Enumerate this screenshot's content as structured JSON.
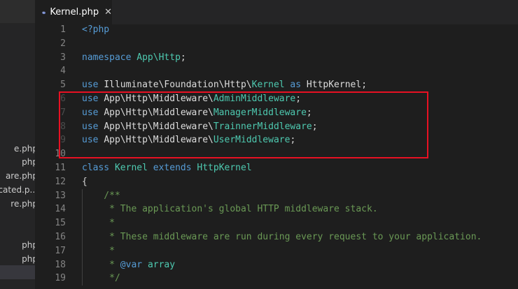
{
  "tab": {
    "title": "Kernel.php",
    "close": "✕",
    "icon": "elephant-php-icon"
  },
  "sidebar": {
    "items": [
      {
        "label": "e.php",
        "selected": false
      },
      {
        "label": "php",
        "selected": false
      },
      {
        "label": "are.php",
        "selected": false
      },
      {
        "label": "icated.p...",
        "selected": false
      },
      {
        "label": "re.php",
        "selected": false
      },
      {
        "label": "php",
        "selected": false
      },
      {
        "label": "php",
        "selected": false
      },
      {
        "label": "",
        "selected": true
      }
    ]
  },
  "editor": {
    "lines": [
      {
        "n": "1",
        "tokens": [
          [
            "kw",
            "<?php"
          ]
        ]
      },
      {
        "n": "2",
        "tokens": []
      },
      {
        "n": "3",
        "tokens": [
          [
            "kw",
            "namespace "
          ],
          [
            "cls",
            "App\\Http"
          ],
          [
            "pl",
            ";"
          ]
        ]
      },
      {
        "n": "4",
        "tokens": []
      },
      {
        "n": "5",
        "tokens": [
          [
            "kw",
            "use "
          ],
          [
            "ns",
            "Illuminate\\Foundation\\Http\\"
          ],
          [
            "cls",
            "Kernel"
          ],
          [
            "kw",
            " as "
          ],
          [
            "ns",
            "HttpKernel"
          ],
          [
            "pl",
            ";"
          ]
        ]
      },
      {
        "n": "6",
        "fade": true,
        "tokens": [
          [
            "kw",
            "use "
          ],
          [
            "ns",
            "App\\Http\\Middleware\\"
          ],
          [
            "cls",
            "AdminMiddleware"
          ],
          [
            "pl",
            ";"
          ]
        ]
      },
      {
        "n": "7",
        "fade": true,
        "tokens": [
          [
            "kw",
            "use "
          ],
          [
            "ns",
            "App\\Http\\Middleware\\"
          ],
          [
            "cls",
            "ManagerMiddleware"
          ],
          [
            "pl",
            ";"
          ]
        ]
      },
      {
        "n": "8",
        "fade": true,
        "tokens": [
          [
            "kw",
            "use "
          ],
          [
            "ns",
            "App\\Http\\Middleware\\"
          ],
          [
            "cls",
            "TrainnerMiddleware"
          ],
          [
            "pl",
            ";"
          ]
        ]
      },
      {
        "n": "9",
        "fade": true,
        "tokens": [
          [
            "kw",
            "use "
          ],
          [
            "ns",
            "App\\Http\\Middleware\\"
          ],
          [
            "cls",
            "UserMiddleware"
          ],
          [
            "pl",
            ";"
          ]
        ]
      },
      {
        "n": "10",
        "tokens": []
      },
      {
        "n": "11",
        "tokens": [
          [
            "kw",
            "class "
          ],
          [
            "cls",
            "Kernel"
          ],
          [
            "kw",
            " extends "
          ],
          [
            "cls",
            "HttpKernel"
          ]
        ]
      },
      {
        "n": "12",
        "tokens": [
          [
            "pl",
            "{"
          ]
        ]
      },
      {
        "n": "13",
        "tokens": [
          [
            "cm",
            "    /**"
          ]
        ]
      },
      {
        "n": "14",
        "tokens": [
          [
            "cm",
            "     * The application's global HTTP middleware stack."
          ]
        ]
      },
      {
        "n": "15",
        "tokens": [
          [
            "cm",
            "     *"
          ]
        ]
      },
      {
        "n": "16",
        "tokens": [
          [
            "cm",
            "     * These middleware are run during every request to your application."
          ]
        ]
      },
      {
        "n": "17",
        "tokens": [
          [
            "cm",
            "     *"
          ]
        ]
      },
      {
        "n": "18",
        "tokens": [
          [
            "cm",
            "     * "
          ],
          [
            "kw",
            "@var"
          ],
          [
            "cm",
            " "
          ],
          [
            "cls",
            "array"
          ]
        ]
      },
      {
        "n": "19",
        "tokens": [
          [
            "cm",
            "     */"
          ]
        ]
      }
    ]
  },
  "colors": {
    "highlight": "#e81123",
    "keyword": "#569cd6",
    "class": "#4ec9b0",
    "comment": "#6a9955"
  }
}
